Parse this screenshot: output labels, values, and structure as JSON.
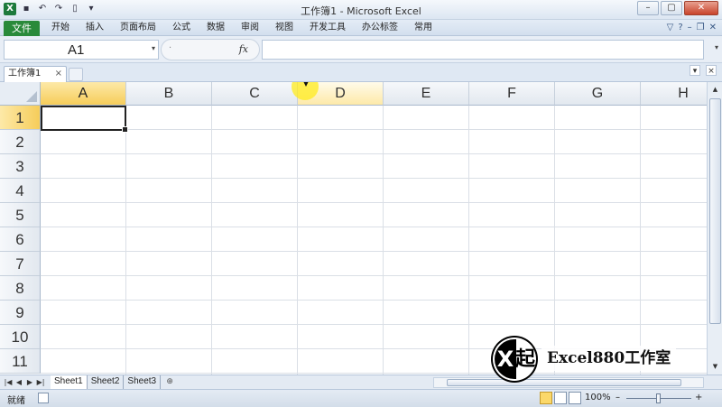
{
  "window": {
    "title": "工作簿1 - Microsoft Excel",
    "controls": {
      "minimize": "–",
      "maximize": "▢",
      "close": "✕"
    }
  },
  "qat": {
    "logo": "X",
    "save": "▪",
    "undo": "↶",
    "redo": "↷",
    "new": "▯",
    "customize": "▾"
  },
  "ribbon": {
    "file_tab": "文件",
    "tabs": [
      "开始",
      "插入",
      "页面布局",
      "公式",
      "数据",
      "审阅",
      "视图",
      "开发工具",
      "办公标签",
      "常用"
    ],
    "right_icons": {
      "collapse": "▽",
      "help": "?",
      "min": "–",
      "restore": "❐",
      "close": "✕"
    }
  },
  "formula_bar": {
    "name_box": "A1",
    "name_dropdown": "▾",
    "separator": "·",
    "fx_label": "fx",
    "formula_value": "",
    "expand": "▾"
  },
  "workbook_tabs": {
    "active": "工作簿1",
    "close": "×",
    "right_controls": {
      "dropdown": "▾",
      "close": "×"
    }
  },
  "grid": {
    "columns": [
      "A",
      "B",
      "C",
      "D",
      "E",
      "F",
      "G",
      "H"
    ],
    "rows": [
      "1",
      "2",
      "3",
      "4",
      "5",
      "6",
      "7",
      "8",
      "9",
      "10",
      "11"
    ],
    "active_cell": "A1",
    "selected_column": "A",
    "highlighted_column": "D"
  },
  "sheets": {
    "nav": [
      "|◀",
      "◀",
      "▶",
      "▶|"
    ],
    "tabs": [
      "Sheet1",
      "Sheet2",
      "Sheet3"
    ],
    "active": "Sheet1",
    "new_sheet": "⊕"
  },
  "scrollbar": {
    "up": "▲",
    "down": "▼"
  },
  "status": {
    "ready": "就绪",
    "zoom": "100%",
    "zoom_minus": "–",
    "zoom_plus": "+"
  },
  "watermark": {
    "logo_letter": "X",
    "logo_glyph": "起",
    "text": "Excel880工作室"
  }
}
